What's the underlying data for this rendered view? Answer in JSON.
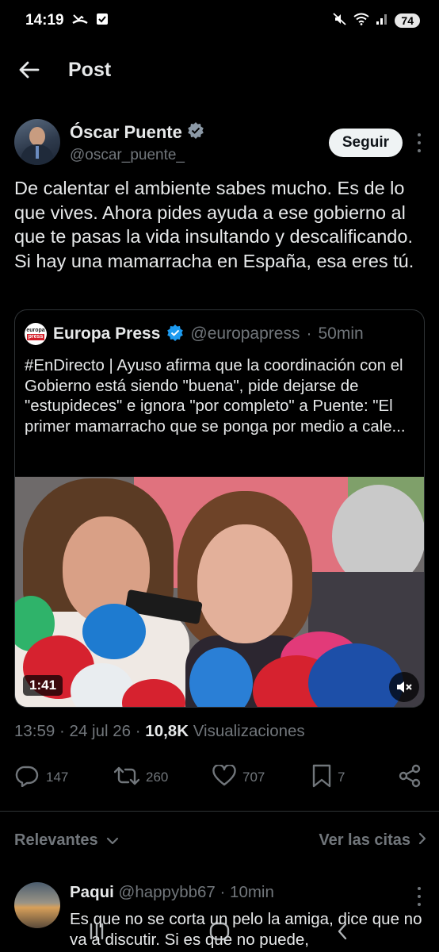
{
  "status_bar": {
    "time": "14:19",
    "battery": "74"
  },
  "header": {
    "title": "Post"
  },
  "author": {
    "name": "Óscar Puente",
    "handle": "@oscar_puente_",
    "follow_label": "Seguir",
    "verified": true
  },
  "post": {
    "text": "De calentar el ambiente sabes mucho. Es de lo que vives. Ahora pides ayuda a ese gobierno al que te pasas la vida insultando y descalificando. Si hay una mamarracha en España, esa eres tú."
  },
  "quote": {
    "logo_line1": "europa",
    "logo_line2": "press",
    "name": "Europa Press",
    "handle": "@europapress",
    "separator": "·",
    "time": "50min",
    "text": "#EnDirecto | Ayuso afirma que la coordinación con el Gobierno está siendo \"buena\", pide dejarse de \"estupideces\" e ignora \"por completo\" a Puente: \"El primer mamarracho que se ponga por medio a cale...",
    "video_duration": "1:41"
  },
  "meta": {
    "time": "13:59",
    "date": "24 jul 26",
    "views_count": "10,8K",
    "views_label": "Visualizaciones"
  },
  "actions": {
    "replies": "147",
    "reposts": "260",
    "likes": "707",
    "bookmarks": "7"
  },
  "replies_section": {
    "sort_label": "Relevantes",
    "quotes_label": "Ver las citas"
  },
  "reply": {
    "name": "Paqui",
    "handle": "@happybb67",
    "time": "10min",
    "text": "Es que no se corta un pelo la amiga, dice que no va a discutir. Si es que no puede,"
  },
  "colors": {
    "background": "#000000",
    "text": "#e7e9ea",
    "muted": "#71767b",
    "verified": "#1d9bf0",
    "border": "#2f3336"
  }
}
